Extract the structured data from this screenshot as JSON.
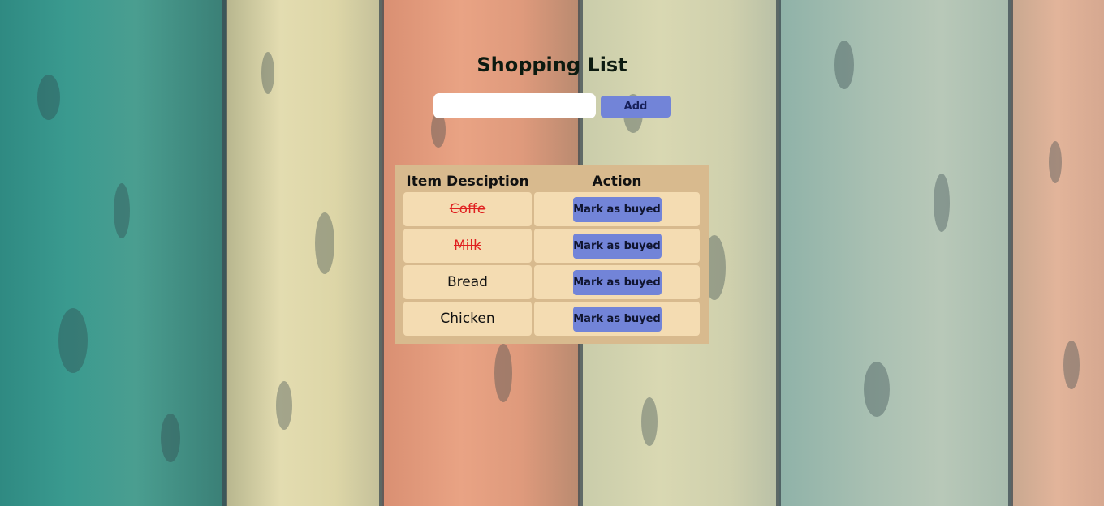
{
  "page": {
    "title": "Shopping List"
  },
  "add_form": {
    "input_value": "",
    "add_label": "Add"
  },
  "table": {
    "headers": {
      "description": "Item Desciption",
      "action": "Action"
    },
    "rows": [
      {
        "item": "Coffe",
        "purchased": true,
        "action_label": "Mark as buyed"
      },
      {
        "item": "Milk",
        "purchased": true,
        "action_label": "Mark as buyed"
      },
      {
        "item": "Bread",
        "purchased": false,
        "action_label": "Mark as buyed"
      },
      {
        "item": "Chicken",
        "purchased": false,
        "action_label": "Mark as buyed"
      }
    ]
  },
  "colors": {
    "button": "#7284d8",
    "panel": "#d8ba8e",
    "cell": "#f4dcb2",
    "purchased_text": "#e02020"
  }
}
